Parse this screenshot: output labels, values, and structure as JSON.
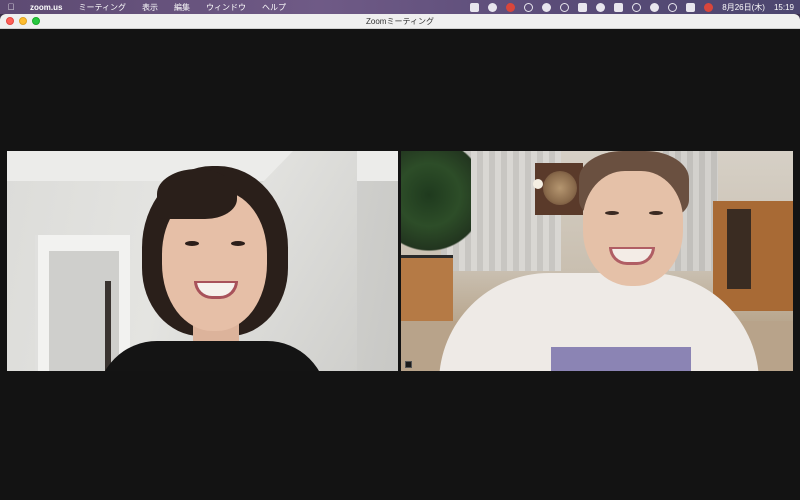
{
  "menubar": {
    "apple_icon": "apple-icon",
    "app_name": "zoom.us",
    "menus": [
      "ミーティング",
      "表示",
      "編集",
      "ウィンドウ",
      "ヘルプ"
    ],
    "clock_date": "8月26日(木)",
    "clock_time": "15:19"
  },
  "window": {
    "title": "Zoomミーティング"
  },
  "colors": {
    "window_background": "#131313",
    "close": "#fe5f57",
    "minimize": "#febc2e",
    "maximize": "#28c840"
  }
}
